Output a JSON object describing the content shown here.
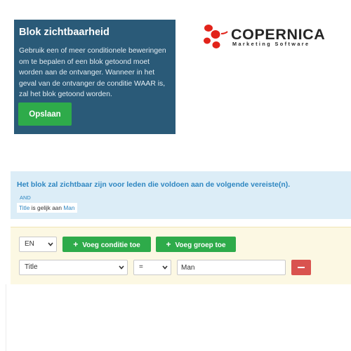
{
  "info_card": {
    "title": "Blok zichtbaarheid",
    "description": "Gebruik een of meer conditionele beweringen om te bepalen of een blok getoond moet worden aan de ontvanger. Wanneer in het geval van de ontvanger de conditie WAAR is, zal het blok getoond worden.",
    "save_label": "Opslaan"
  },
  "logo": {
    "word": "COPERNICA",
    "tagline": "Marketing Software",
    "colors": {
      "mark": "#e2231a",
      "text": "#262626"
    }
  },
  "summary": {
    "heading": "Het blok zal zichtbaar zijn voor leden die voldoen aan de volgende vereiste(n).",
    "operator": "AND",
    "condition": {
      "field": "Title",
      "relation": "is gelijk aan",
      "value": "Man"
    }
  },
  "editor": {
    "language": "EN",
    "add_condition_label": "Voeg conditie toe",
    "add_group_label": "Voeg groep toe",
    "row": {
      "field": "Title",
      "operator": "=",
      "value": "Man"
    }
  },
  "colors": {
    "card_bg": "#2a5a78",
    "green": "#2eab4a",
    "summary_bg": "#dcedf7",
    "editor_bg": "#fcf8e3",
    "link_blue": "#2e86c1",
    "danger": "#d9534f"
  }
}
